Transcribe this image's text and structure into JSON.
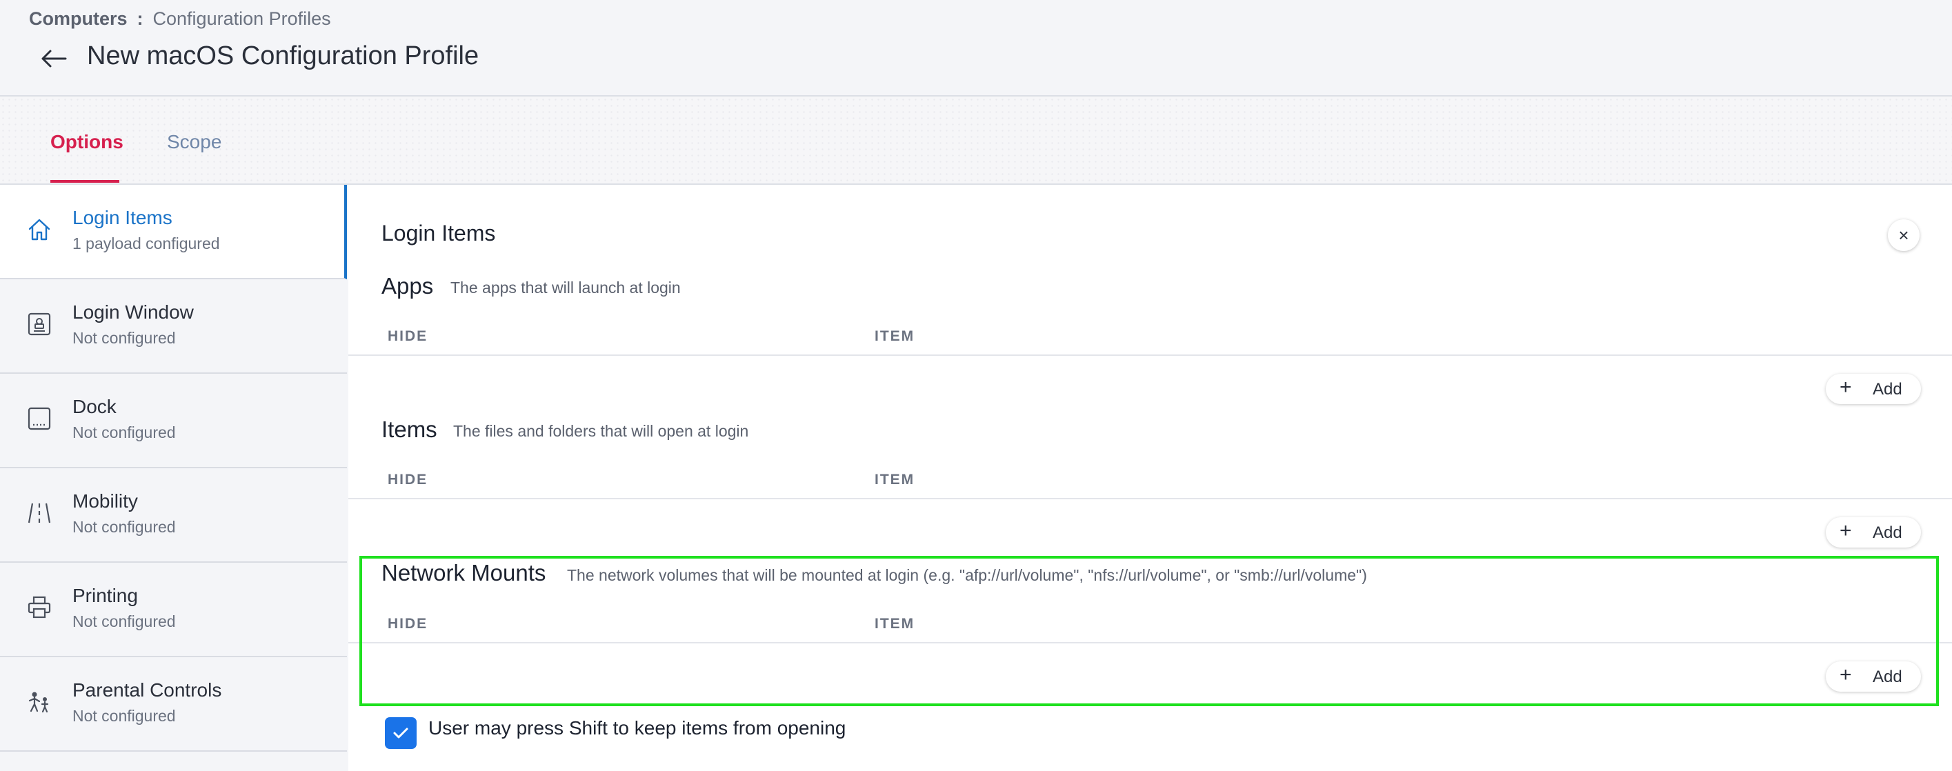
{
  "breadcrumb": {
    "root": "Computers",
    "separator": ":",
    "current": "Configuration Profiles"
  },
  "page_title": "New macOS Configuration Profile",
  "tabs": [
    {
      "label": "Options",
      "active": true
    },
    {
      "label": "Scope",
      "active": false
    }
  ],
  "sidebar": {
    "items": [
      {
        "label": "Login Items",
        "status": "1 payload configured",
        "icon": "home-icon",
        "active": true
      },
      {
        "label": "Login Window",
        "status": "Not configured",
        "icon": "login-window-icon"
      },
      {
        "label": "Dock",
        "status": "Not configured",
        "icon": "dock-icon"
      },
      {
        "label": "Mobility",
        "status": "Not configured",
        "icon": "mobility-icon"
      },
      {
        "label": "Printing",
        "status": "Not configured",
        "icon": "printer-icon"
      },
      {
        "label": "Parental Controls",
        "status": "Not configured",
        "icon": "parental-controls-icon"
      }
    ]
  },
  "main": {
    "title": "Login Items",
    "close_symbol": "×",
    "sections": [
      {
        "title": "Apps",
        "description": "The apps that will launch at login",
        "col_hide": "HIDE",
        "col_item": "ITEM",
        "add_label": "Add"
      },
      {
        "title": "Items",
        "description": "The files and folders that will open at login",
        "col_hide": "HIDE",
        "col_item": "ITEM",
        "add_label": "Add"
      },
      {
        "title": "Network Mounts",
        "description": "The network volumes that will be mounted at login (e.g. \"afp://url/volume\", \"nfs://url/volume\", or \"smb://url/volume\")",
        "col_hide": "HIDE",
        "col_item": "ITEM",
        "add_label": "Add"
      }
    ],
    "shift_checkbox": {
      "label": "User may press Shift to keep items from opening",
      "checked": true
    }
  },
  "colors": {
    "accent_tab": "#d6204e",
    "active_link": "#1a73c8",
    "checkbox": "#1a73e8",
    "highlight": "#1ee01e"
  }
}
